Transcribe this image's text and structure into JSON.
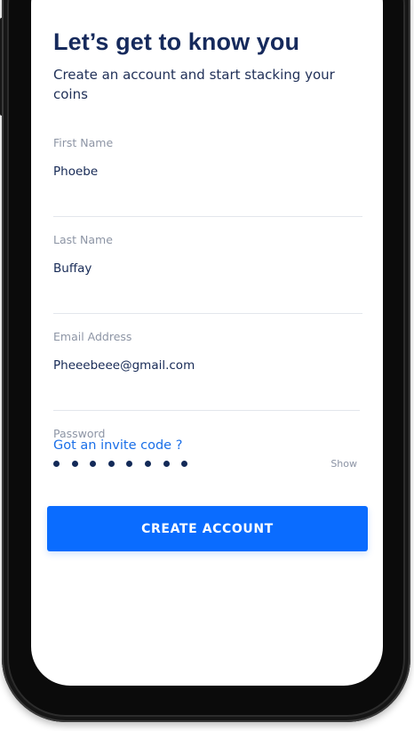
{
  "header": {
    "title": "Let’s get to know you",
    "subtitle": "Create an account and start stacking your coins"
  },
  "form": {
    "first_name": {
      "label": "First Name",
      "value": "Phoebe"
    },
    "last_name": {
      "label": "Last Name",
      "value": "Buffay"
    },
    "email": {
      "label": "Email Address",
      "value": "Pheeebeee@gmail.com"
    },
    "password": {
      "label": "Password",
      "masked_length": 8,
      "show_label": "Show"
    }
  },
  "invite_link_label": "Got an invite code ?",
  "create_button_label": "CREATE ACCOUNT",
  "colors": {
    "primary": "#0a6cff",
    "title": "#162a5c",
    "link": "#1a6fe8",
    "label": "#8d95a5",
    "divider": "#e3e6ec"
  }
}
